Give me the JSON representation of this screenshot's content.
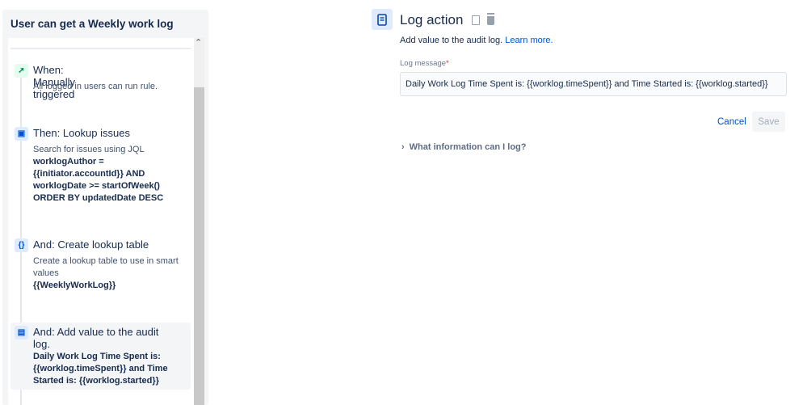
{
  "rule_title": "User can get a Weekly work log",
  "steps": [
    {
      "title": "When: Manually triggered",
      "desc": "All logged in users can run rule.",
      "icon": "cursor-icon"
    },
    {
      "title": "Then: Lookup issues",
      "desc": "Search for issues using JQL",
      "bold": "worklogAuthor = {{initiator.accountId}} AND worklogDate >= startOfWeek() ORDER BY updatedDate DESC",
      "icon": "lookup-icon"
    },
    {
      "title": "And: Create lookup table",
      "desc": "Create a lookup table to use in smart values",
      "bold": "{{WeeklyWorkLog}}",
      "icon": "braces-icon"
    },
    {
      "title": "And: Add value to the audit log.",
      "bold": "Daily Work Log Time Spent is: {{worklog.timeSpent}} and Time Started is: {{worklog.started}}",
      "icon": "log-icon"
    }
  ],
  "detail": {
    "title": "Log action",
    "desc": "Add value to the audit log.",
    "learn_more": "Learn more.",
    "field_label": "Log message",
    "required": "*",
    "field_value": "Daily Work Log Time Spent is: {{worklog.timeSpent}} and Time Started is: {{worklog.started}}",
    "cancel": "Cancel",
    "save": "Save",
    "expand": "What information can I log?"
  }
}
